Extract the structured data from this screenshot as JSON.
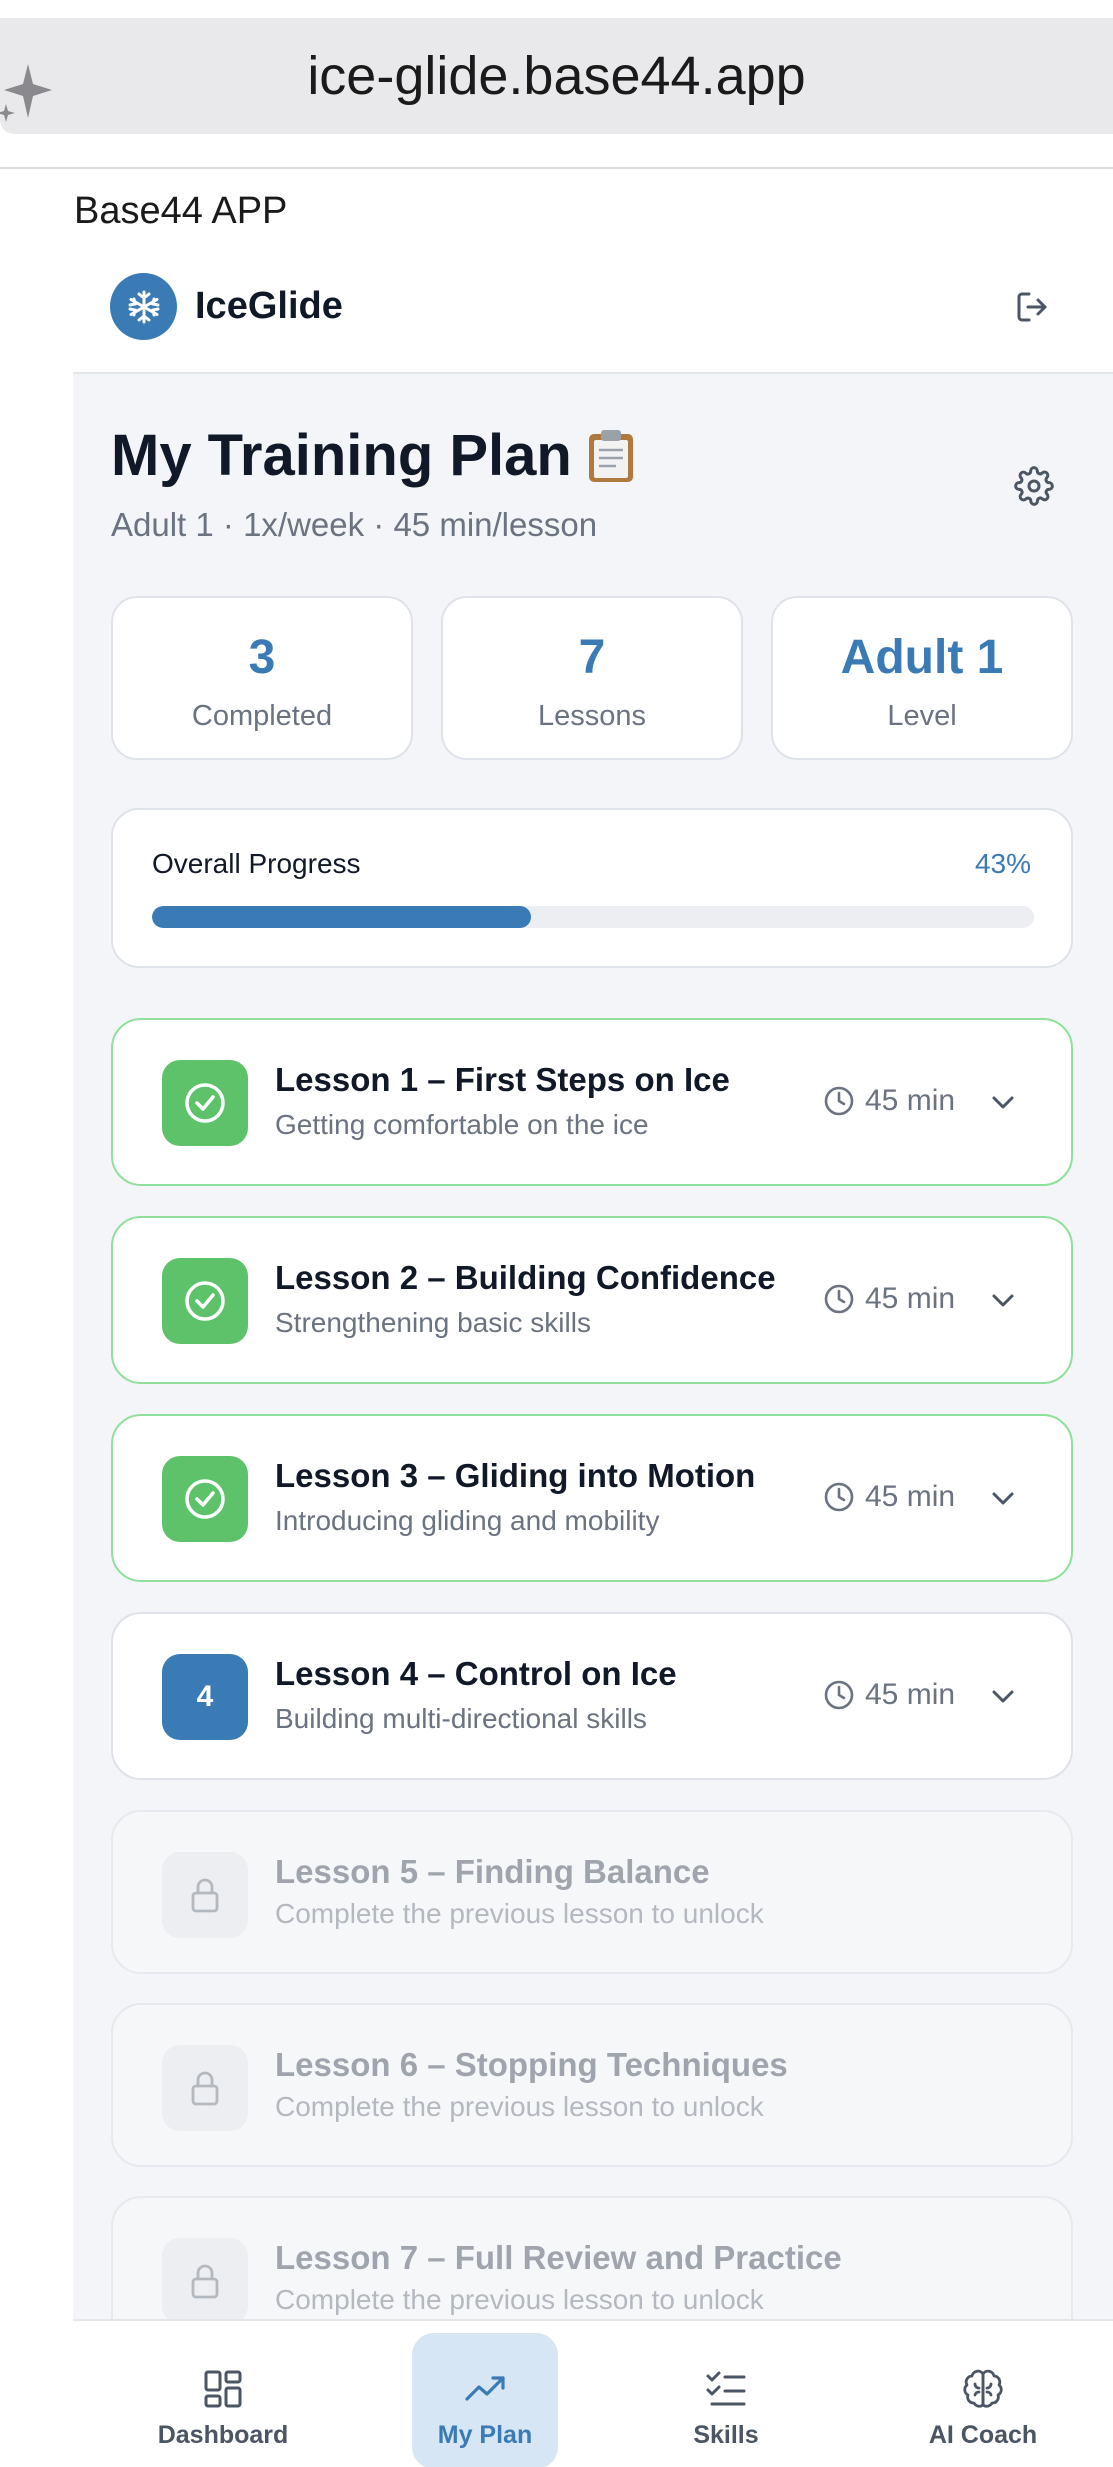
{
  "browser": {
    "url": "ice-glide.base44.app"
  },
  "app_label": "Base44 APP",
  "header": {
    "brand": "IceGlide",
    "logo_icon": "snowflake-icon",
    "logout_icon": "logout-icon"
  },
  "page": {
    "title": "My Training Plan",
    "title_emoji": "clipboard-icon",
    "subtitle": "Adult 1 · 1x/week · 45 min/lesson"
  },
  "stats": [
    {
      "value": "3",
      "label": "Completed"
    },
    {
      "value": "7",
      "label": "Lessons"
    },
    {
      "value": "Adult 1",
      "label": "Level"
    }
  ],
  "progress": {
    "label": "Overall Progress",
    "percent_text": "43%",
    "value": 0.43
  },
  "lessons": [
    {
      "title": "Lesson 1 – First Steps on Ice",
      "subtitle": "Getting comfortable on the ice",
      "duration": "45 min",
      "status": "completed"
    },
    {
      "title": "Lesson 2 – Building Confidence",
      "subtitle": "Strengthening basic skills",
      "duration": "45 min",
      "status": "completed"
    },
    {
      "title": "Lesson 3 – Gliding into Motion",
      "subtitle": "Introducing gliding and mobility",
      "duration": "45 min",
      "status": "completed"
    },
    {
      "title": "Lesson 4 – Control on Ice",
      "subtitle": "Building multi-directional skills",
      "duration": "45 min",
      "status": "current",
      "number": "4"
    },
    {
      "title": "Lesson 5 – Finding Balance",
      "subtitle": "Complete the previous lesson to unlock",
      "status": "locked"
    },
    {
      "title": "Lesson 6 – Stopping Techniques",
      "subtitle": "Complete the previous lesson to unlock",
      "status": "locked"
    },
    {
      "title": "Lesson 7 – Full Review and Practice",
      "subtitle": "Complete the previous lesson to unlock",
      "status": "locked"
    }
  ],
  "nav": [
    {
      "label": "Dashboard",
      "icon": "dashboard-grid-icon"
    },
    {
      "label": "My Plan",
      "icon": "trending-up-icon",
      "active": true
    },
    {
      "label": "Skills",
      "icon": "checklist-icon"
    },
    {
      "label": "AI Coach",
      "icon": "brain-icon"
    }
  ],
  "colors": {
    "accent": "#3a7bb5",
    "success": "#5ec26a",
    "background": "#f3f5f8"
  }
}
